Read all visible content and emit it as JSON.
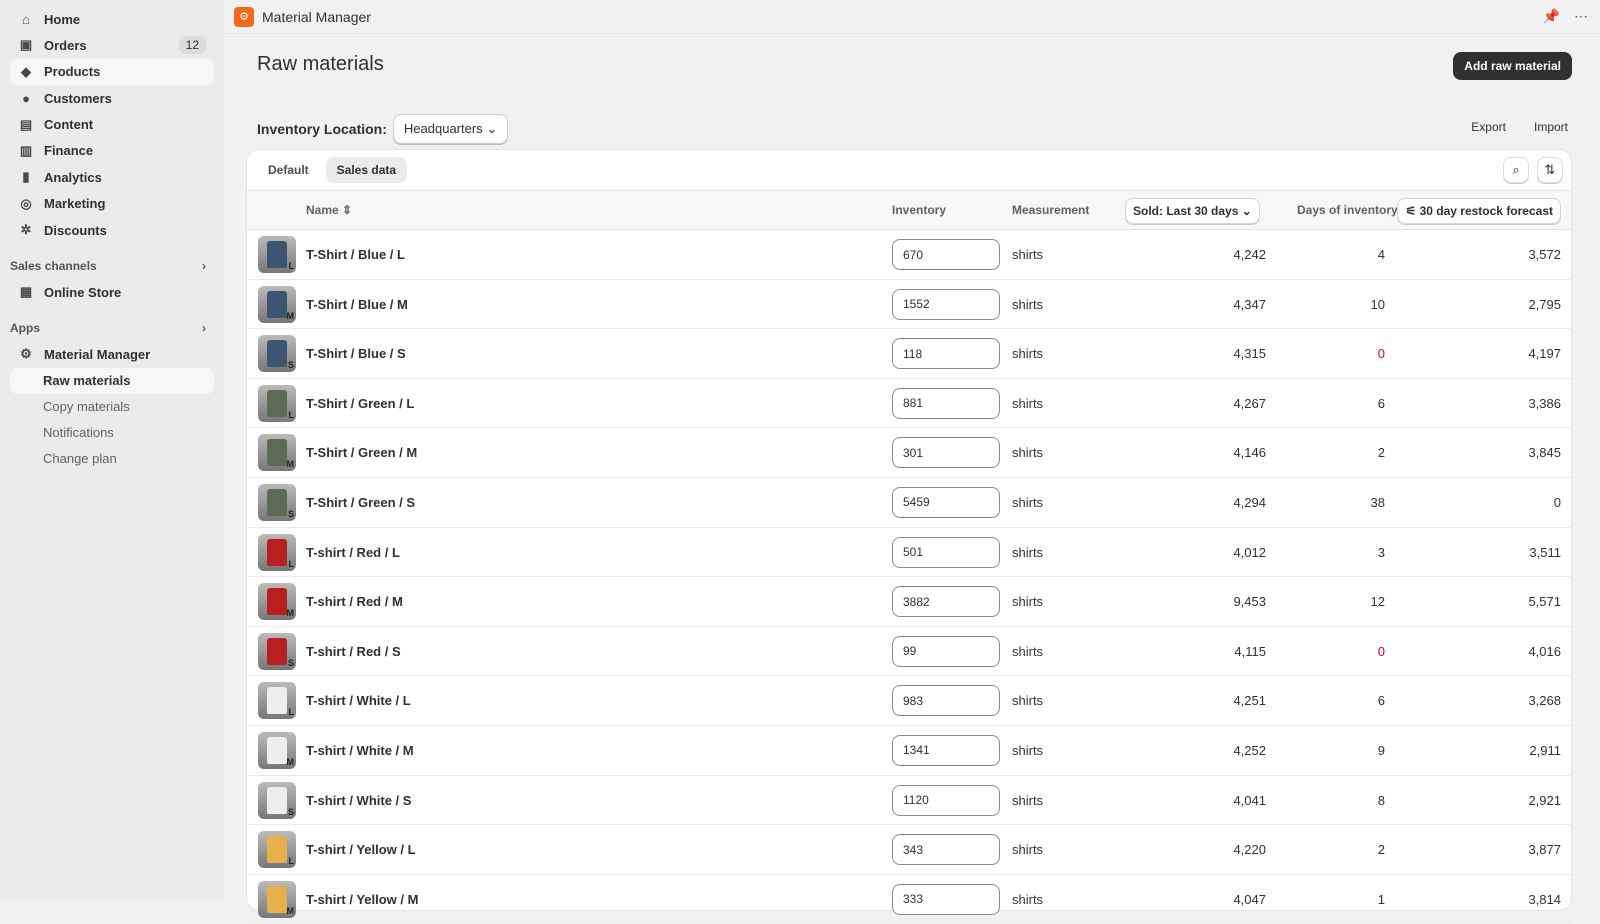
{
  "sidebar": {
    "items": [
      {
        "label": "Home",
        "icon": "home-icon",
        "glyph": "⌂"
      },
      {
        "label": "Orders",
        "icon": "inbox-icon",
        "glyph": "▣",
        "badge": "12"
      },
      {
        "label": "Products",
        "icon": "tag-icon",
        "glyph": "◆",
        "active": true
      },
      {
        "label": "Customers",
        "icon": "person-icon",
        "glyph": "●"
      },
      {
        "label": "Content",
        "icon": "image-icon",
        "glyph": "▤"
      },
      {
        "label": "Finance",
        "icon": "bank-icon",
        "glyph": "▥"
      },
      {
        "label": "Analytics",
        "icon": "bar-chart-icon",
        "glyph": "▮"
      },
      {
        "label": "Marketing",
        "icon": "target-icon",
        "glyph": "◎"
      },
      {
        "label": "Discounts",
        "icon": "discount-icon",
        "glyph": "✲"
      }
    ],
    "sales_channels": "Sales channels",
    "online_store": "Online Store",
    "apps": "Apps",
    "app_name": "Material Manager",
    "app_items": [
      {
        "label": "Raw materials",
        "active": true
      },
      {
        "label": "Copy materials"
      },
      {
        "label": "Notifications"
      },
      {
        "label": "Change plan"
      }
    ]
  },
  "topbar": {
    "app_title": "Material Manager"
  },
  "page": {
    "title": "Raw materials",
    "add_button": "Add raw material",
    "location_label": "Inventory Location:",
    "location_value": "Headquarters",
    "export": "Export",
    "import": "Import"
  },
  "tabs": [
    "Default",
    "Sales data"
  ],
  "columns": {
    "name": "Name",
    "inventory": "Inventory",
    "measurement": "Measurement",
    "sold": "Sold: Last 30 days",
    "days": "Days of inventory",
    "forecast": "30 day restock forecast"
  },
  "colors": {
    "accent": "#303030",
    "zero_days": "#c70a24",
    "logo": "#f26b1d"
  },
  "rows": [
    {
      "name": "T-Shirt / Blue / L",
      "size": "L",
      "color": "#3d5670",
      "inventory": "670",
      "measurement": "shirts",
      "sold": "4,242",
      "days": "4",
      "forecast": "3,572"
    },
    {
      "name": "T-Shirt / Blue / M",
      "size": "M",
      "color": "#3d5670",
      "inventory": "1552",
      "measurement": "shirts",
      "sold": "4,347",
      "days": "10",
      "forecast": "2,795"
    },
    {
      "name": "T-Shirt / Blue / S",
      "size": "S",
      "color": "#3d5670",
      "inventory": "118",
      "measurement": "shirts",
      "sold": "4,315",
      "days": "0",
      "forecast": "4,197"
    },
    {
      "name": "T-Shirt / Green / L",
      "size": "L",
      "color": "#5c6b52",
      "inventory": "881",
      "measurement": "shirts",
      "sold": "4,267",
      "days": "6",
      "forecast": "3,386"
    },
    {
      "name": "T-Shirt / Green / M",
      "size": "M",
      "color": "#5c6b52",
      "inventory": "301",
      "measurement": "shirts",
      "sold": "4,146",
      "days": "2",
      "forecast": "3,845"
    },
    {
      "name": "T-Shirt / Green / S",
      "size": "S",
      "color": "#5c6b52",
      "inventory": "5459",
      "measurement": "shirts",
      "sold": "4,294",
      "days": "38",
      "forecast": "0"
    },
    {
      "name": "T-shirt / Red / L",
      "size": "L",
      "color": "#b82020",
      "inventory": "501",
      "measurement": "shirts",
      "sold": "4,012",
      "days": "3",
      "forecast": "3,511"
    },
    {
      "name": "T-shirt / Red / M",
      "size": "M",
      "color": "#b82020",
      "inventory": "3882",
      "measurement": "shirts",
      "sold": "9,453",
      "days": "12",
      "forecast": "5,571"
    },
    {
      "name": "T-shirt / Red / S",
      "size": "S",
      "color": "#b82020",
      "inventory": "99",
      "measurement": "shirts",
      "sold": "4,115",
      "days": "0",
      "forecast": "4,016"
    },
    {
      "name": "T-shirt / White / L",
      "size": "L",
      "color": "#eeeeee",
      "inventory": "983",
      "measurement": "shirts",
      "sold": "4,251",
      "days": "6",
      "forecast": "3,268"
    },
    {
      "name": "T-shirt / White / M",
      "size": "M",
      "color": "#eeeeee",
      "inventory": "1341",
      "measurement": "shirts",
      "sold": "4,252",
      "days": "9",
      "forecast": "2,911"
    },
    {
      "name": "T-shirt / White / S",
      "size": "S",
      "color": "#eeeeee",
      "inventory": "1120",
      "measurement": "shirts",
      "sold": "4,041",
      "days": "8",
      "forecast": "2,921"
    },
    {
      "name": "T-shirt / Yellow / L",
      "size": "L",
      "color": "#e8b04a",
      "inventory": "343",
      "measurement": "shirts",
      "sold": "4,220",
      "days": "2",
      "forecast": "3,877"
    },
    {
      "name": "T-shirt / Yellow / M",
      "size": "M",
      "color": "#e8b04a",
      "inventory": "333",
      "measurement": "shirts",
      "sold": "4,047",
      "days": "1",
      "forecast": "3,814"
    }
  ]
}
